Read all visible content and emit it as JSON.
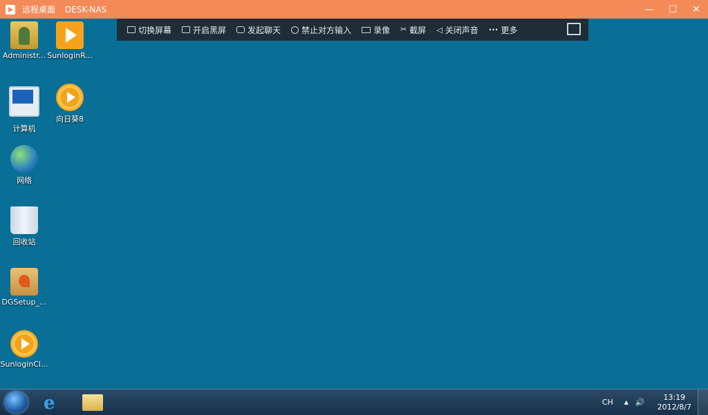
{
  "window": {
    "title": "远程桌面",
    "host": "DESK-NAS",
    "controls": [
      "—",
      "☐",
      "✕"
    ]
  },
  "toolbar": {
    "items": [
      {
        "label": "切换屏幕",
        "icon": "switch-screen-icon"
      },
      {
        "label": "开启黑屏",
        "icon": "black-screen-icon"
      },
      {
        "label": "发起聊天",
        "icon": "chat-icon"
      },
      {
        "label": "禁止对方输入",
        "icon": "forbid-input-icon"
      },
      {
        "label": "录像",
        "icon": "record-icon"
      },
      {
        "label": "截屏",
        "icon": "screenshot-icon"
      },
      {
        "label": "关闭声音",
        "icon": "speaker-icon"
      },
      {
        "label": "更多",
        "icon": "more-icon"
      }
    ]
  },
  "desktop": {
    "icons": [
      {
        "label": "Administr...",
        "icon": "user-folder-icon"
      },
      {
        "label": "SunloginR...",
        "icon": "sunlogin-remote-icon"
      },
      {
        "label": "计算机",
        "icon": "computer-icon"
      },
      {
        "label": "向日葵8",
        "icon": "sunlogin-icon"
      },
      {
        "label": "网络",
        "icon": "network-icon"
      },
      {
        "label": "回收站",
        "icon": "recycle-bin-icon"
      },
      {
        "label": "DGSetup_...",
        "icon": "setup-package-icon"
      },
      {
        "label": "SunloginCl...",
        "icon": "sunlogin-client-icon"
      }
    ]
  },
  "taskbar": {
    "language": "CH",
    "tray_arrow": "▲",
    "volume": "🔊",
    "time": "13:19",
    "date": "2012/8/7"
  }
}
